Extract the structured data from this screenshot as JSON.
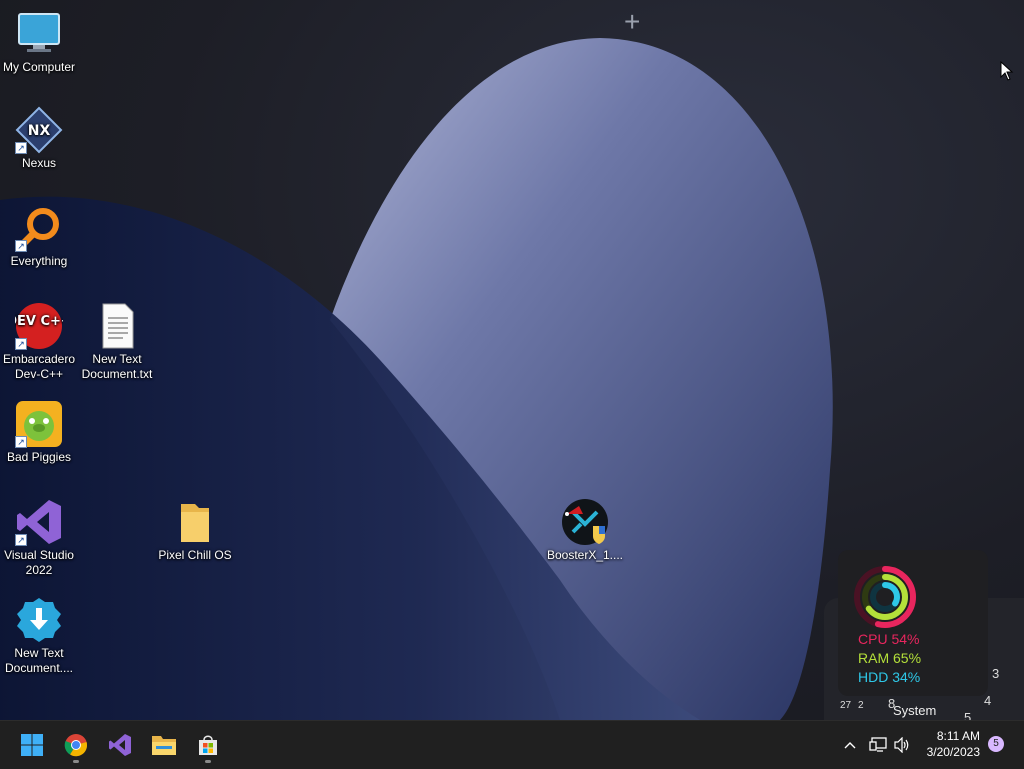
{
  "desktop": {
    "icons": [
      {
        "label": "My Computer",
        "icon": "monitor-icon"
      },
      {
        "label": "Nexus",
        "icon": "nexus-icon"
      },
      {
        "label": "Everything",
        "icon": "search-magnifier-icon"
      },
      {
        "label": "Embarcadero Dev-C++",
        "icon": "devcpp-icon",
        "badge": "DEV C++"
      },
      {
        "label": "New Text Document.txt",
        "icon": "text-document-icon"
      },
      {
        "label": "Bad Piggies",
        "icon": "bad-piggies-icon"
      },
      {
        "label": "Visual Studio 2022",
        "icon": "visual-studio-icon"
      },
      {
        "label": "Pixel Chill OS",
        "icon": "folder-icon"
      },
      {
        "label": "BoosterX_1....",
        "icon": "boosterx-icon"
      },
      {
        "label": "New Text Document....",
        "icon": "download-installer-icon"
      }
    ]
  },
  "widget": {
    "cpu": "CPU 54%",
    "ram": "RAM 65%",
    "hdd": "HDD 34%",
    "cpu_value": 0.54,
    "ram_value": 0.65,
    "hdd_value": 0.34,
    "colors": {
      "cpu": "#e8265e",
      "ram": "#b4e03a",
      "hdd": "#2ec8e8"
    },
    "system_label": "System",
    "clock_numbers": [
      "3",
      "4",
      "5",
      "8",
      "27",
      "2"
    ]
  },
  "taskbar": {
    "apps": [
      {
        "name": "Start",
        "icon": "windows-start-icon"
      },
      {
        "name": "Google Chrome",
        "icon": "chrome-icon"
      },
      {
        "name": "Visual Studio",
        "icon": "visual-studio-icon"
      },
      {
        "name": "File Explorer",
        "icon": "file-explorer-icon"
      },
      {
        "name": "Microsoft Store",
        "icon": "store-icon"
      }
    ],
    "tray": {
      "time": "8:11 AM",
      "date": "3/20/2023",
      "notifications": "5"
    }
  }
}
